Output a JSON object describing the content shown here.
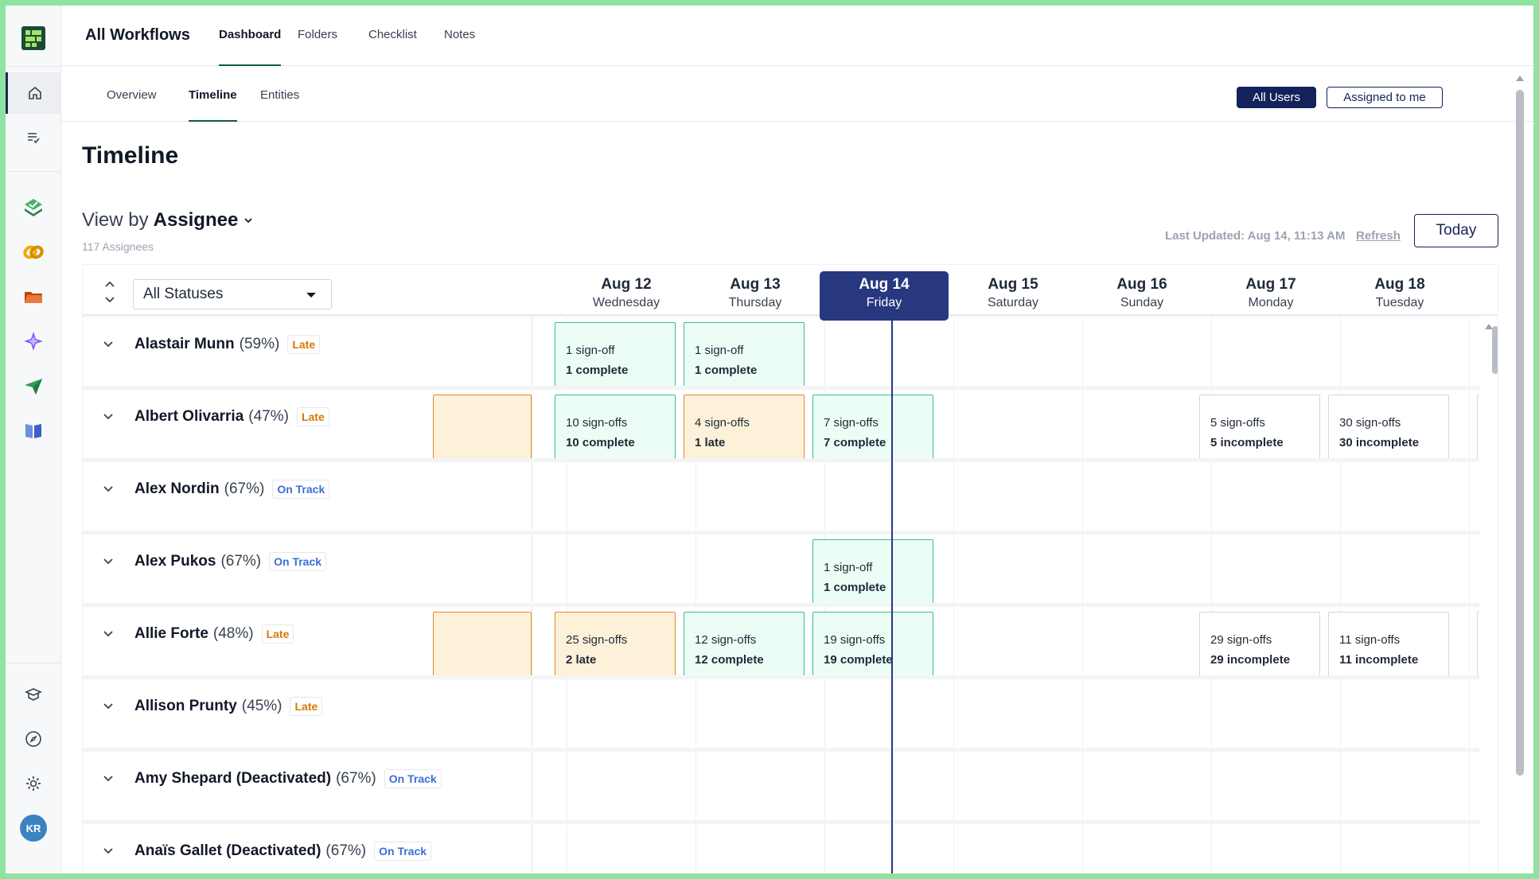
{
  "sidebar": {
    "icons": [
      "home-icon",
      "tasks-icon",
      "checklist-app-icon",
      "link-app-icon",
      "folder-app-icon",
      "sparkle-app-icon",
      "send-app-icon",
      "book-app-icon",
      "learn-icon",
      "compass-icon",
      "gear-icon"
    ],
    "avatar": "KR"
  },
  "topnav": {
    "title": "All Workflows",
    "tabs": [
      "Dashboard",
      "Folders",
      "Checklist",
      "Notes"
    ],
    "active": "Dashboard"
  },
  "subnav": {
    "tabs": [
      "Overview",
      "Timeline",
      "Entities"
    ],
    "active": "Timeline",
    "all_users": "All Users",
    "assigned_to_me": "Assigned to me"
  },
  "page": {
    "title": "Timeline",
    "view_by_prefix": "View by",
    "view_by_value": "Assignee",
    "count": "117 Assignees",
    "last_updated": "Last Updated: Aug 14, 11:13 AM",
    "refresh": "Refresh",
    "today": "Today"
  },
  "filter": {
    "status": "All Statuses"
  },
  "dates": [
    {
      "date": "Aug 12",
      "weekday": "Wednesday"
    },
    {
      "date": "Aug 13",
      "weekday": "Thursday"
    },
    {
      "date": "Aug 14",
      "weekday": "Friday",
      "today": true
    },
    {
      "date": "Aug 15",
      "weekday": "Saturday"
    },
    {
      "date": "Aug 16",
      "weekday": "Sunday"
    },
    {
      "date": "Aug 17",
      "weekday": "Monday"
    },
    {
      "date": "Aug 18",
      "weekday": "Tuesday"
    }
  ],
  "rows": [
    {
      "name": "Alastair Munn",
      "pct": "(59%)",
      "status": "Late",
      "cells": [
        {
          "col": 0,
          "line1": "1 sign-off",
          "line2": "1 complete",
          "kind": "green"
        },
        {
          "col": 1,
          "line1": "1 sign-off",
          "line2": "1 complete",
          "kind": "green"
        }
      ]
    },
    {
      "name": "Albert Olivarria",
      "pct": "(47%)",
      "status": "Late",
      "cells": [
        {
          "col": 0,
          "line1": "10 sign-offs",
          "line2": "10 complete",
          "kind": "green"
        },
        {
          "col": 1,
          "line1": "4 sign-offs",
          "line2": "1 late",
          "kind": "orange"
        },
        {
          "col": 2,
          "line1": "7 sign-offs",
          "line2": "7 complete",
          "kind": "green"
        },
        {
          "col": 5,
          "line1": "5 sign-offs",
          "line2": "5 incomplete",
          "kind": "white"
        },
        {
          "col": 6,
          "line1": "30 sign-offs",
          "line2": "30 incomplete",
          "kind": "white"
        }
      ]
    },
    {
      "name": "Alex Nordin",
      "pct": "(67%)",
      "status": "On Track",
      "cells": []
    },
    {
      "name": "Alex Pukos",
      "pct": "(67%)",
      "status": "On Track",
      "cells": [
        {
          "col": 2,
          "line1": "1 sign-off",
          "line2": "1 complete",
          "kind": "green"
        }
      ]
    },
    {
      "name": "Allie Forte",
      "pct": "(48%)",
      "status": "Late",
      "cells": [
        {
          "col": 0,
          "line1": "25 sign-offs",
          "line2": "2 late",
          "kind": "orange"
        },
        {
          "col": 1,
          "line1": "12 sign-offs",
          "line2": "12 complete",
          "kind": "green"
        },
        {
          "col": 2,
          "line1": "19 sign-offs",
          "line2": "19 complete",
          "kind": "green"
        },
        {
          "col": 5,
          "line1": "29 sign-offs",
          "line2": "29 incomplete",
          "kind": "white"
        },
        {
          "col": 6,
          "line1": "11 sign-offs",
          "line2": "11 incomplete",
          "kind": "white"
        }
      ]
    },
    {
      "name": "Allison Prunty",
      "pct": "(45%)",
      "status": "Late",
      "cells": []
    },
    {
      "name": "Amy Shepard (Deactivated)",
      "pct": "(67%)",
      "status": "On Track",
      "cells": []
    },
    {
      "name": "Anaïs Gallet (Deactivated)",
      "pct": "(67%)",
      "status": "On Track",
      "cells": []
    }
  ],
  "colors": {
    "brand_navy": "#13225b",
    "today_col": "#27387e",
    "green": "#34c08a",
    "orange": "#e08a28",
    "late": "#d97706",
    "on_track": "#3b6fd6"
  }
}
